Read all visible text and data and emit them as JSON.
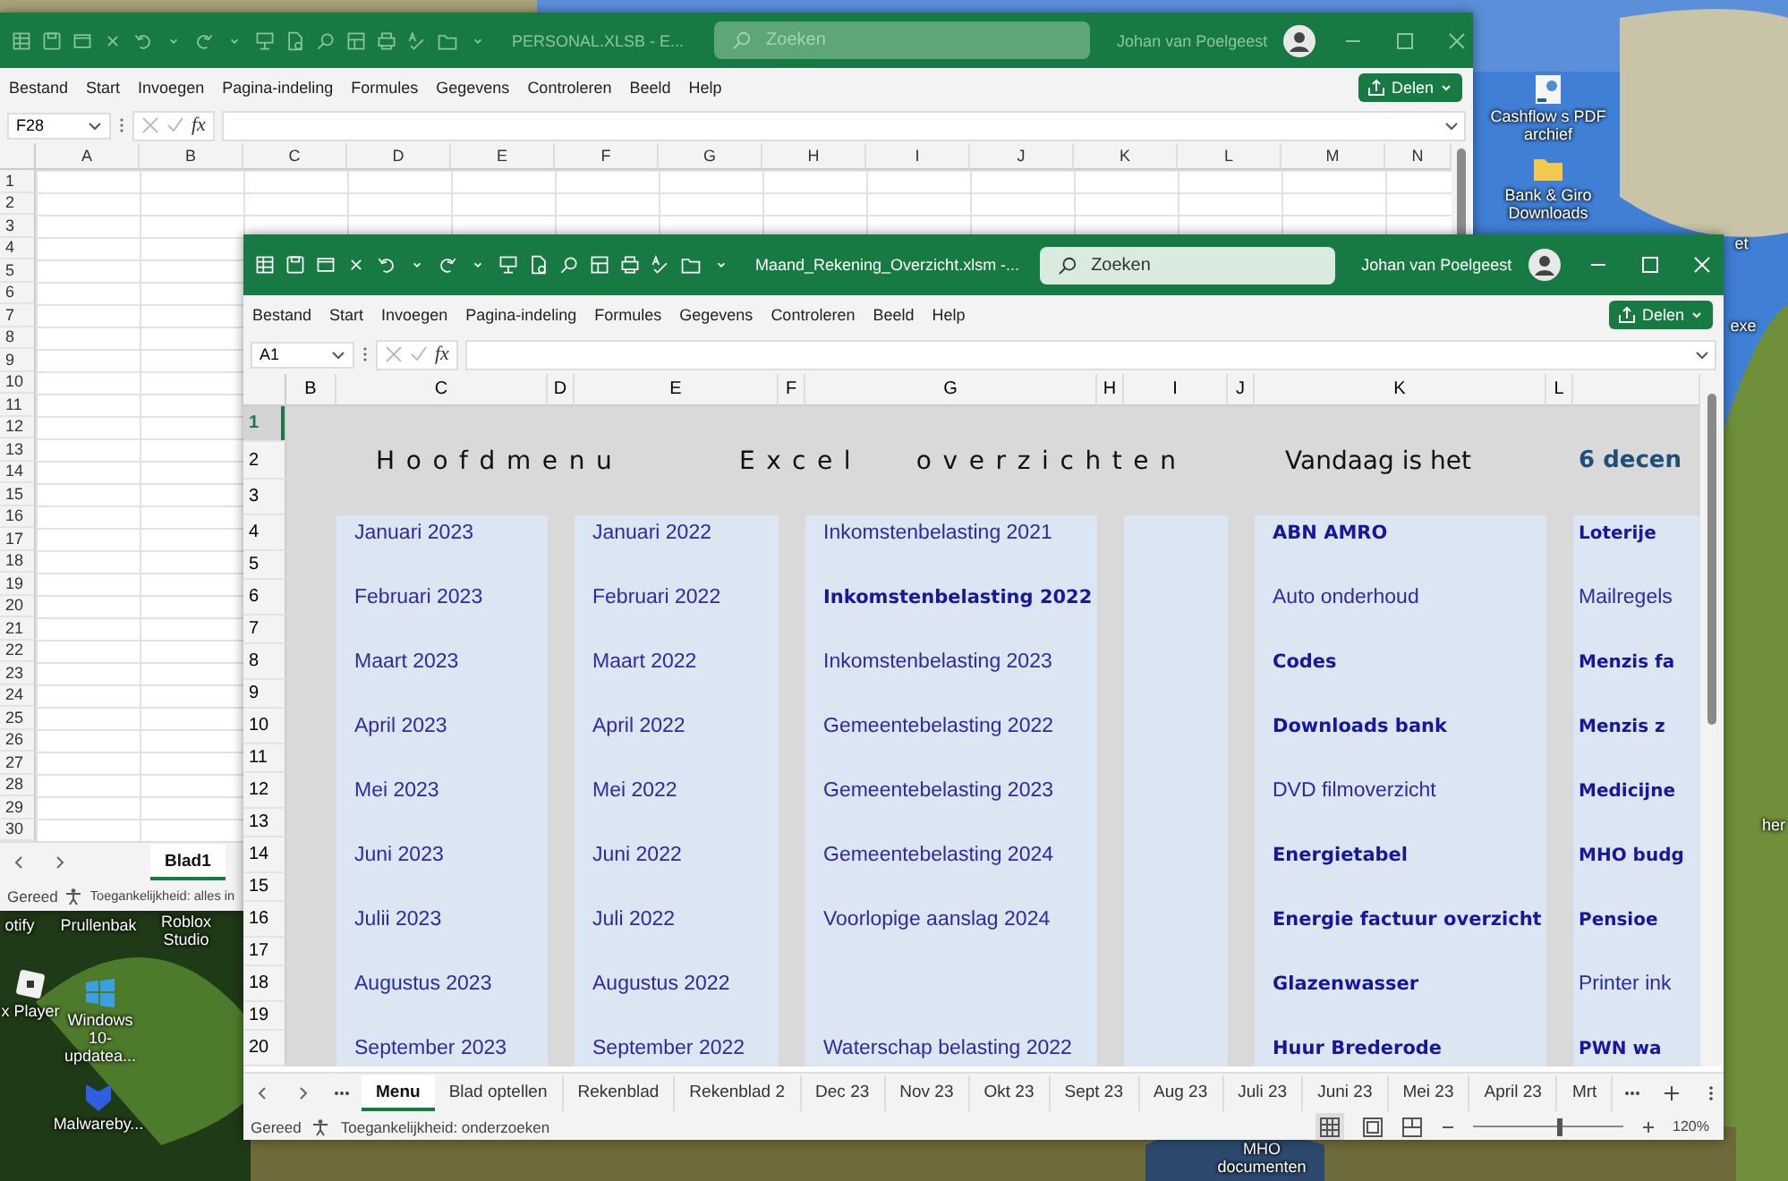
{
  "desktop": {
    "kind": "picture",
    "icons": [
      {
        "label": "Cashflow s PDF archief",
        "kind": "shortcut"
      },
      {
        "label": "Bank & Giro Downloads",
        "kind": "folder"
      },
      {
        "label": "et"
      },
      {
        "label": "exe"
      },
      {
        "label": "her"
      },
      {
        "label": "otify"
      },
      {
        "label": "Prullenbak"
      },
      {
        "label": "Roblox Studio"
      },
      {
        "label": "x Player",
        "kind": "app"
      },
      {
        "label": "Windows 10-updatea...",
        "kind": "windows"
      },
      {
        "label": "Malwareby...",
        "kind": "shield"
      },
      {
        "label": "MHO documenten"
      }
    ]
  },
  "back_window": {
    "title": "PERSONAL.XLSB - E...",
    "search": {
      "placeholder": "Zoeken"
    },
    "user": "Johan van Poelgeest",
    "menu": [
      "Bestand",
      "Start",
      "Invoegen",
      "Pagina-indeling",
      "Formules",
      "Gegevens",
      "Controleren",
      "Beeld",
      "Help"
    ],
    "share": "Delen",
    "name_box": "F28",
    "fx": "fx",
    "columns": [
      "A",
      "B",
      "C",
      "D",
      "E",
      "F",
      "G",
      "H",
      "I",
      "J",
      "K",
      "L",
      "M",
      "N"
    ],
    "rows": [
      "1",
      "2",
      "3",
      "4",
      "5",
      "6",
      "7",
      "8",
      "9",
      "10",
      "11",
      "12",
      "13",
      "14",
      "15",
      "16",
      "17",
      "18",
      "19",
      "20",
      "21",
      "22",
      "23",
      "24",
      "25",
      "26",
      "27",
      "28",
      "29",
      "30"
    ],
    "sheet_tabs": [
      {
        "label": "Blad1",
        "selected": true
      }
    ],
    "status": "Gereed",
    "accessibility": "Toegankelijkheid: alles in"
  },
  "front_window": {
    "title": "Maand_Rekening_Overzicht.xlsm -...",
    "search": {
      "placeholder": "Zoeken"
    },
    "user": "Johan van Poelgeest",
    "menu": [
      "Bestand",
      "Start",
      "Invoegen",
      "Pagina-indeling",
      "Formules",
      "Gegevens",
      "Controleren",
      "Beeld",
      "Help"
    ],
    "share": "Delen",
    "name_box": "A1",
    "fx": "fx",
    "columns": [
      "B",
      "C",
      "D",
      "E",
      "F",
      "G",
      "H",
      "I",
      "J",
      "K",
      "L"
    ],
    "rows": [
      {
        "label": "1",
        "selected": true
      },
      {
        "label": "2",
        "selected": false
      },
      {
        "label": "3",
        "selected": false
      },
      {
        "label": "4",
        "selected": false
      },
      {
        "label": "5",
        "selected": false
      },
      {
        "label": "6",
        "selected": false
      },
      {
        "label": "7",
        "selected": false
      },
      {
        "label": "8",
        "selected": false
      },
      {
        "label": "9",
        "selected": false
      },
      {
        "label": "10",
        "selected": false
      },
      {
        "label": "11",
        "selected": false
      },
      {
        "label": "12",
        "selected": false
      },
      {
        "label": "13",
        "selected": false
      },
      {
        "label": "14",
        "selected": false
      },
      {
        "label": "15",
        "selected": false
      },
      {
        "label": "16",
        "selected": false
      },
      {
        "label": "17",
        "selected": false
      },
      {
        "label": "18",
        "selected": false
      },
      {
        "label": "19",
        "selected": false
      },
      {
        "label": "20",
        "selected": false
      }
    ],
    "headings": [
      {
        "text": "Hoofdmenu",
        "kind": "spaced"
      },
      {
        "text": "Excel overzichten",
        "kind": "spaced"
      },
      {
        "text": "Vandaag is het",
        "kind": "plain"
      },
      {
        "text": "6 decen",
        "kind": "date"
      }
    ],
    "panels": [
      {
        "kind": "links",
        "items": [
          {
            "text": "Januari 2023",
            "bold": false
          },
          {
            "text": "Februari 2023",
            "bold": false
          },
          {
            "text": "Maart 2023",
            "bold": false
          },
          {
            "text": "April 2023",
            "bold": false
          },
          {
            "text": "Mei 2023",
            "bold": false
          },
          {
            "text": "Juni 2023",
            "bold": false
          },
          {
            "text": "Julii 2023",
            "bold": false
          },
          {
            "text": "Augustus 2023",
            "bold": false
          },
          {
            "text": "September 2023",
            "bold": false
          }
        ]
      },
      {
        "kind": "links",
        "items": [
          {
            "text": "Januari 2022",
            "bold": false
          },
          {
            "text": "Februari 2022",
            "bold": false
          },
          {
            "text": "Maart 2022",
            "bold": false
          },
          {
            "text": "April 2022",
            "bold": false
          },
          {
            "text": "Mei 2022",
            "bold": false
          },
          {
            "text": "Juni 2022",
            "bold": false
          },
          {
            "text": "Juli 2022",
            "bold": false
          },
          {
            "text": "Augustus 2022",
            "bold": false
          },
          {
            "text": "September 2022",
            "bold": false
          }
        ]
      },
      {
        "kind": "links",
        "items": [
          {
            "text": "Inkomstenbelasting 2021",
            "bold": false
          },
          {
            "text": "Inkomstenbelasting 2022",
            "bold": true
          },
          {
            "text": "Inkomstenbelasting 2023",
            "bold": false
          },
          {
            "text": "Gemeentebelasting 2022",
            "bold": false
          },
          {
            "text": "Gemeentebelasting 2023",
            "bold": false
          },
          {
            "text": "Gemeentebelasting 2024",
            "bold": false
          },
          {
            "text": "Voorlopige aanslag 2024",
            "bold": false
          },
          {
            "text": "Waterschap belasting 2022",
            "bold": false,
            "after_blank_row": true
          }
        ]
      },
      {
        "kind": "empty"
      },
      {
        "kind": "links",
        "items": [
          {
            "text": "ABN AMRO",
            "bold": true
          },
          {
            "text": "Auto onderhoud",
            "bold": false
          },
          {
            "text": "Codes",
            "bold": true
          },
          {
            "text": "Downloads bank",
            "bold": true
          },
          {
            "text": "DVD filmoverzicht",
            "bold": false
          },
          {
            "text": "Energietabel",
            "bold": true
          },
          {
            "text": "Energie factuur overzicht",
            "bold": true
          },
          {
            "text": "Glazenwasser",
            "bold": true
          },
          {
            "text": "Huur Brederode",
            "bold": true
          }
        ]
      },
      {
        "kind": "links",
        "items": [
          {
            "text": "Loterije",
            "bold": true
          },
          {
            "text": "Mailregels",
            "bold": false
          },
          {
            "text": "Menzis fa",
            "bold": true
          },
          {
            "text": "Menzis z",
            "bold": true
          },
          {
            "text": "Medicijne",
            "bold": true
          },
          {
            "text": "MHO budg",
            "bold": true
          },
          {
            "text": "Pensioe",
            "bold": true
          },
          {
            "text": "Printer ink",
            "bold": false
          },
          {
            "text": "PWN wa",
            "bold": true
          }
        ]
      }
    ],
    "sheet_tabs": [
      {
        "label": "Menu",
        "selected": true
      },
      {
        "label": "Blad optellen",
        "selected": false
      },
      {
        "label": "Rekenblad",
        "selected": false
      },
      {
        "label": "Rekenblad 2",
        "selected": false
      },
      {
        "label": "Dec 23",
        "selected": false
      },
      {
        "label": "Nov 23",
        "selected": false
      },
      {
        "label": "Okt 23",
        "selected": false
      },
      {
        "label": "Sept 23",
        "selected": false
      },
      {
        "label": "Aug 23",
        "selected": false
      },
      {
        "label": "Juli 23",
        "selected": false
      },
      {
        "label": "Juni 23",
        "selected": false
      },
      {
        "label": "Mei 23",
        "selected": false
      },
      {
        "label": "April 23",
        "selected": false
      },
      {
        "label": "Mrt",
        "selected": false
      }
    ],
    "status": "Gereed",
    "accessibility": "Toegankelijkheid: onderzoeken",
    "zoom": {
      "level": 0.58,
      "reading": "120%"
    }
  }
}
